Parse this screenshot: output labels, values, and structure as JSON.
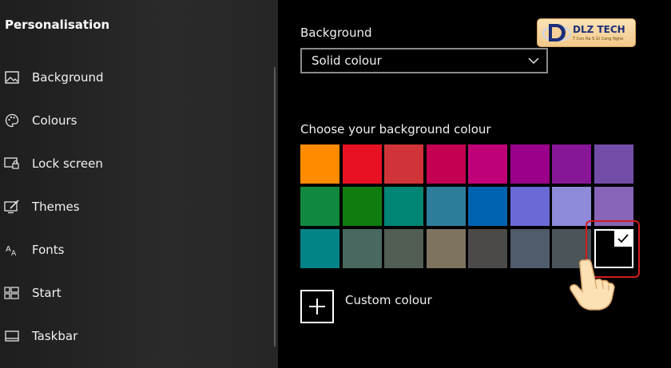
{
  "sidebar": {
    "title": "Personalisation",
    "items": [
      {
        "label": "Background",
        "icon": "picture-icon"
      },
      {
        "label": "Colours",
        "icon": "palette-icon"
      },
      {
        "label": "Lock screen",
        "icon": "lock-screen-icon"
      },
      {
        "label": "Themes",
        "icon": "themes-icon"
      },
      {
        "label": "Fonts",
        "icon": "fonts-icon"
      },
      {
        "label": "Start",
        "icon": "start-icon"
      },
      {
        "label": "Taskbar",
        "icon": "taskbar-icon"
      }
    ]
  },
  "main": {
    "background_label": "Background",
    "background_value": "Solid colour",
    "choose_label": "Choose your background colour",
    "swatches": [
      [
        "#ff8c00",
        "#e81123",
        "#d13438",
        "#c30052",
        "#bf0077",
        "#9a0089",
        "#881798",
        "#744da9"
      ],
      [
        "#10893e",
        "#107c10",
        "#018574",
        "#2d7d9a",
        "#0063b1",
        "#6b69d6",
        "#8e8cd8",
        "#8764b8"
      ],
      [
        "#038387",
        "#486860",
        "#525e54",
        "#7e735f",
        "#4c4a48",
        "#515c6b",
        "#4a5459",
        "#000000"
      ]
    ],
    "selected_swatch": "#000000",
    "custom_colour_label": "Custom colour"
  },
  "logo": {
    "text": "DLZ TECH",
    "subtext": "T Con Ra S Gi Cong Nghe"
  },
  "colors": {
    "highlight": "#d01c1c",
    "sidebar_bg": "#2a2a2a"
  }
}
